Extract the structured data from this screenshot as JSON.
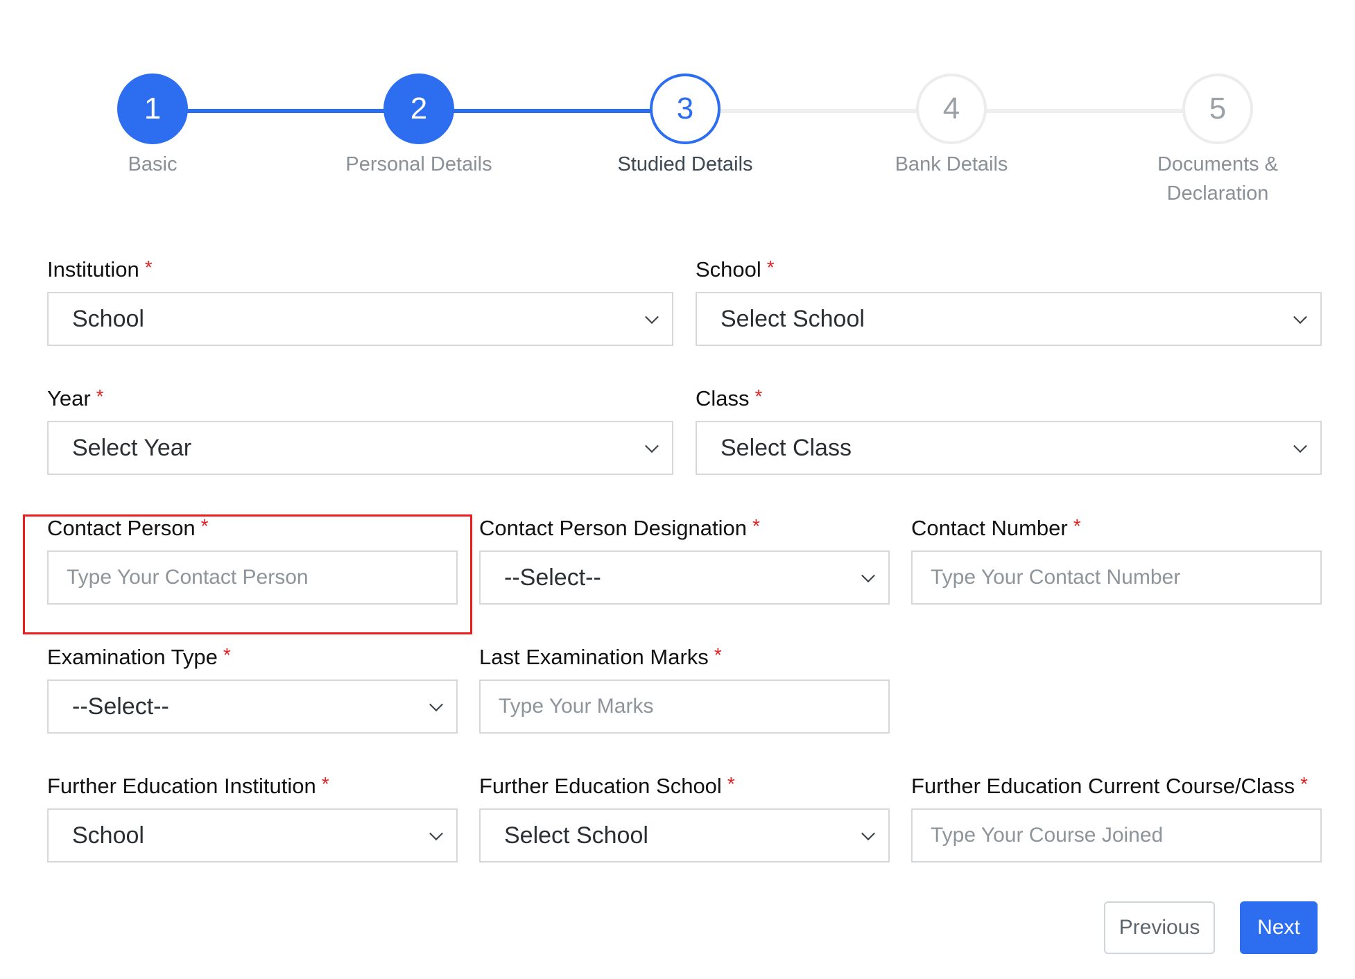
{
  "stepper": {
    "steps": [
      {
        "number": "1",
        "label": "Basic",
        "state": "completed"
      },
      {
        "number": "2",
        "label": "Personal Details",
        "state": "completed"
      },
      {
        "number": "3",
        "label": "Studied Details",
        "state": "active"
      },
      {
        "number": "4",
        "label": "Bank Details",
        "state": "pending"
      },
      {
        "number": "5",
        "label": "Documents & Declaration",
        "state": "pending"
      }
    ]
  },
  "form": {
    "institution": {
      "label": "Institution",
      "value": "School"
    },
    "school": {
      "label": "School",
      "value": "Select School"
    },
    "year": {
      "label": "Year",
      "value": "Select Year"
    },
    "class": {
      "label": "Class",
      "value": "Select Class"
    },
    "contact_person": {
      "label": "Contact Person",
      "placeholder": "Type Your Contact Person"
    },
    "contact_person_designation": {
      "label": "Contact Person Designation",
      "value": "--Select--"
    },
    "contact_number": {
      "label": "Contact Number",
      "placeholder": "Type Your Contact Number"
    },
    "examination_type": {
      "label": "Examination Type",
      "value": "--Select--"
    },
    "last_examination_marks": {
      "label": "Last Examination Marks",
      "placeholder": "Type Your Marks"
    },
    "further_education_institution": {
      "label": "Further Education Institution",
      "value": "School"
    },
    "further_education_school": {
      "label": "Further Education School",
      "value": "Select School"
    },
    "further_education_course": {
      "label": "Further Education Current Course/Class",
      "placeholder": "Type Your Course Joined"
    },
    "required_marker": "*"
  },
  "buttons": {
    "previous": "Previous",
    "next": "Next"
  },
  "colors": {
    "primary": "#2d6ef0",
    "required": "#e02424",
    "highlight": "#ee1c1c"
  }
}
